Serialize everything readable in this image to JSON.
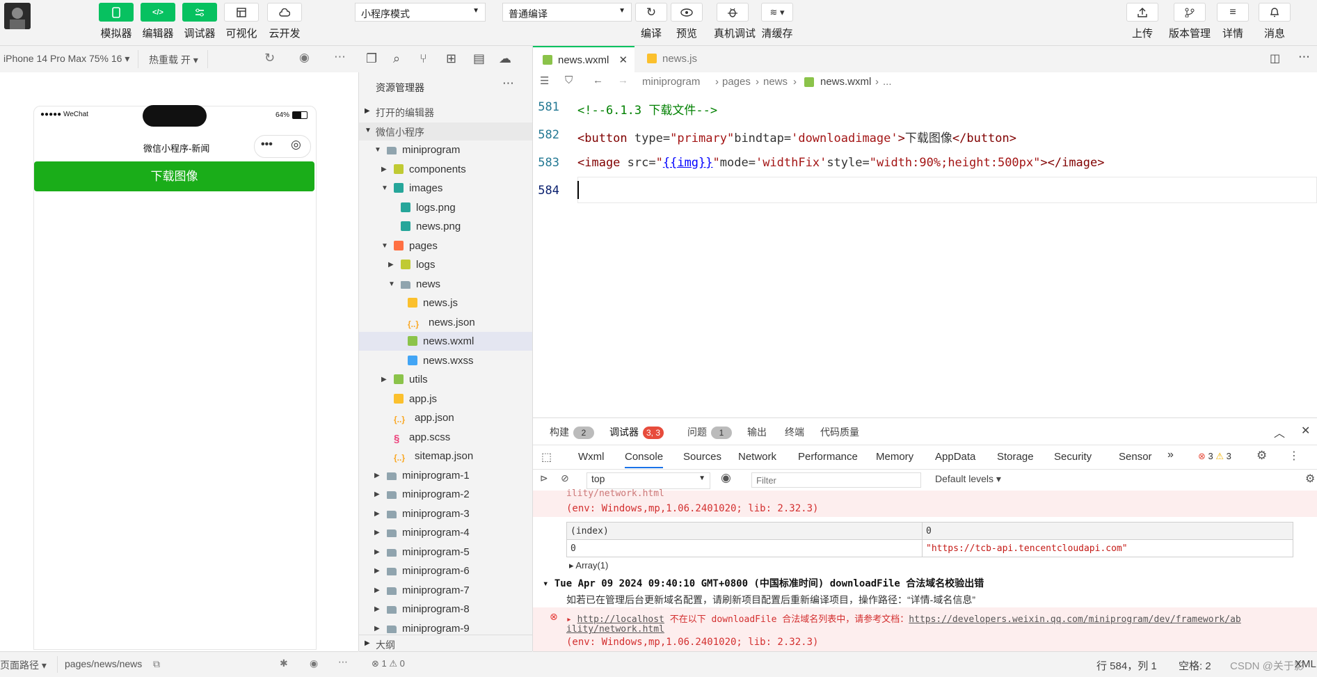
{
  "toolbar": {
    "left_buttons": [
      "模拟器",
      "编辑器",
      "调试器",
      "可视化",
      "云开发"
    ],
    "mode_select": "小程序模式",
    "compile_select": "普通编译",
    "mid_buttons": [
      "编译",
      "预览",
      "真机调试",
      "清缓存"
    ],
    "right_buttons": [
      "上传",
      "版本管理",
      "详情",
      "消息"
    ]
  },
  "simulator": {
    "device": "iPhone 14 Pro Max 75% 16",
    "hot_reload": "热重载 开",
    "status_left": "●●●●● WeChat",
    "battery": "64%",
    "nav_title": "微信小程序-新闻",
    "download_button": "下载图像",
    "page_path_label": "页面路径",
    "page_path": "pages/news/news"
  },
  "explorer": {
    "title": "资源管理器",
    "open_editors": "打开的编辑器",
    "project": "微信小程序",
    "tree": [
      {
        "label": "miniprogram",
        "icon": "folder",
        "depth": 0,
        "arrow": "down"
      },
      {
        "label": "components",
        "icon": "folder-yellow",
        "depth": 1,
        "arrow": "right"
      },
      {
        "label": "images",
        "icon": "folder-teal",
        "depth": 1,
        "arrow": "down"
      },
      {
        "label": "logs.png",
        "icon": "png",
        "depth": 2,
        "arrow": ""
      },
      {
        "label": "news.png",
        "icon": "png",
        "depth": 2,
        "arrow": ""
      },
      {
        "label": "pages",
        "icon": "folder-orange",
        "depth": 1,
        "arrow": "down"
      },
      {
        "label": "logs",
        "icon": "folder-yellow",
        "depth": 2,
        "arrow": "right"
      },
      {
        "label": "news",
        "icon": "folder",
        "depth": 2,
        "arrow": "down"
      },
      {
        "label": "news.js",
        "icon": "js",
        "depth": 3,
        "arrow": ""
      },
      {
        "label": "news.json",
        "icon": "json",
        "depth": 3,
        "arrow": ""
      },
      {
        "label": "news.wxml",
        "icon": "wxml",
        "depth": 3,
        "arrow": "",
        "selected": true
      },
      {
        "label": "news.wxss",
        "icon": "wxss",
        "depth": 3,
        "arrow": ""
      },
      {
        "label": "utils",
        "icon": "folder-green",
        "depth": 1,
        "arrow": "right"
      },
      {
        "label": "app.js",
        "icon": "js",
        "depth": 1,
        "arrow": ""
      },
      {
        "label": "app.json",
        "icon": "json",
        "depth": 1,
        "arrow": ""
      },
      {
        "label": "app.scss",
        "icon": "scss",
        "depth": 1,
        "arrow": ""
      },
      {
        "label": "sitemap.json",
        "icon": "json",
        "depth": 1,
        "arrow": ""
      },
      {
        "label": "miniprogram-1",
        "icon": "folder",
        "depth": 0,
        "arrow": "right"
      },
      {
        "label": "miniprogram-2",
        "icon": "folder",
        "depth": 0,
        "arrow": "right"
      },
      {
        "label": "miniprogram-3",
        "icon": "folder",
        "depth": 0,
        "arrow": "right"
      },
      {
        "label": "miniprogram-4",
        "icon": "folder",
        "depth": 0,
        "arrow": "right"
      },
      {
        "label": "miniprogram-5",
        "icon": "folder",
        "depth": 0,
        "arrow": "right"
      },
      {
        "label": "miniprogram-6",
        "icon": "folder",
        "depth": 0,
        "arrow": "right"
      },
      {
        "label": "miniprogram-7",
        "icon": "folder",
        "depth": 0,
        "arrow": "right"
      },
      {
        "label": "miniprogram-8",
        "icon": "folder",
        "depth": 0,
        "arrow": "right"
      },
      {
        "label": "miniprogram-9",
        "icon": "folder",
        "depth": 0,
        "arrow": "right"
      }
    ],
    "outline": "大纲",
    "errors": "1",
    "warnings": "0"
  },
  "editor": {
    "tabs": [
      "news.wxml",
      "news.js"
    ],
    "breadcrumb": [
      "miniprogram",
      "pages",
      "news",
      "news.wxml",
      "..."
    ],
    "lines": [
      {
        "no": "581"
      },
      {
        "no": "582"
      },
      {
        "no": "583"
      },
      {
        "no": "584"
      }
    ],
    "code": {
      "l581": "<!--6.1.3 下载文件-->",
      "l582_open": "<button",
      "l582_attr1": " type=",
      "l582_val1": "\"primary\"",
      "l582_attr2": "bindtap=",
      "l582_val2": "'downloadimage'",
      "l582_gt": ">",
      "l582_text": "下载图像",
      "l582_close": "</button>",
      "l583_open": "<image",
      "l583_attr1": " src=",
      "l583_q1": "\"",
      "l583_bind": "{{img}}",
      "l583_q2": "\"",
      "l583_attr2": "mode=",
      "l583_val2": "'widthFix'",
      "l583_attr3": "style=",
      "l583_val3": "\"width:90%;height:500px\"",
      "l583_close": "></image>"
    }
  },
  "panel": {
    "tabs": [
      {
        "label": "构建",
        "badge": "2"
      },
      {
        "label": "调试器",
        "badge": "3, 3"
      },
      {
        "label": "问题",
        "badge": "1"
      },
      {
        "label": "输出",
        "badge": ""
      },
      {
        "label": "终端",
        "badge": ""
      },
      {
        "label": "代码质量",
        "badge": ""
      }
    ],
    "devtools_tabs": [
      "Wxml",
      "Console",
      "Sources",
      "Network",
      "Performance",
      "Memory",
      "AppData",
      "Storage",
      "Security",
      "Sensor"
    ],
    "error_count": "3",
    "warn_count": "3",
    "context": "top",
    "filter_placeholder": "Filter",
    "levels": "Default levels",
    "log1_cut": "ility/network.html",
    "log1_env": "(env: Windows,mp,1.06.2401020; lib: 2.32.3)",
    "table": {
      "headers": [
        "(index)",
        "0"
      ],
      "row": [
        "0",
        "\"https://tcb-api.tencentcloudapi.com\""
      ]
    },
    "array": "Array(1)",
    "group_title": "Tue Apr 09 2024 09:40:10 GMT+0800 (中国标准时间) downloadFile 合法域名校验出错",
    "info": "如若已在管理后台更新域名配置，请刷新项目配置后重新编译项目，操作路径：“详情-域名信息”",
    "err_link": "http://localhost",
    "err_text": " 不在以下 downloadFile 合法域名列表中，请参考文档：",
    "err_doc": "https://developers.weixin.qq.com/miniprogram/dev/framework/ab",
    "err_doc2": "ility/network.html",
    "err_env": "(env: Windows,mp,1.06.2401020; lib: 2.32.3)"
  },
  "statusbar": {
    "position": "行 584，列 1",
    "spaces": "空格: 2",
    "watermark": "CSDN @关于影",
    "tail": "XML"
  }
}
